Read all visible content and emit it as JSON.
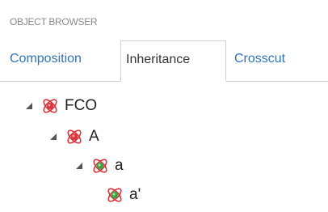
{
  "panel": {
    "title": "OBJECT BROWSER"
  },
  "tabs": [
    {
      "label": "Composition",
      "active": false
    },
    {
      "label": "Inheritance",
      "active": true
    },
    {
      "label": "Crosscut",
      "active": false
    }
  ],
  "tree": {
    "nodes": [
      {
        "label": "FCO",
        "expanded": true,
        "icon": "fco-atom-icon",
        "icon_color": "#d9343a"
      },
      {
        "label": "A",
        "expanded": true,
        "icon": "fco-atom-icon",
        "icon_color": "#d9343a"
      },
      {
        "label": "a",
        "expanded": true,
        "icon": "instance-atom-icon",
        "icon_color": "#3aa845"
      },
      {
        "label": "a'",
        "expanded": false,
        "icon": "instance-atom-icon",
        "icon_color": "#3aa845"
      }
    ]
  },
  "colors": {
    "tab_link": "#2f74b8",
    "tab_active_text": "#333333",
    "title_text": "#8a8a8a",
    "fco_red": "#d9343a",
    "instance_green": "#3aa845"
  }
}
